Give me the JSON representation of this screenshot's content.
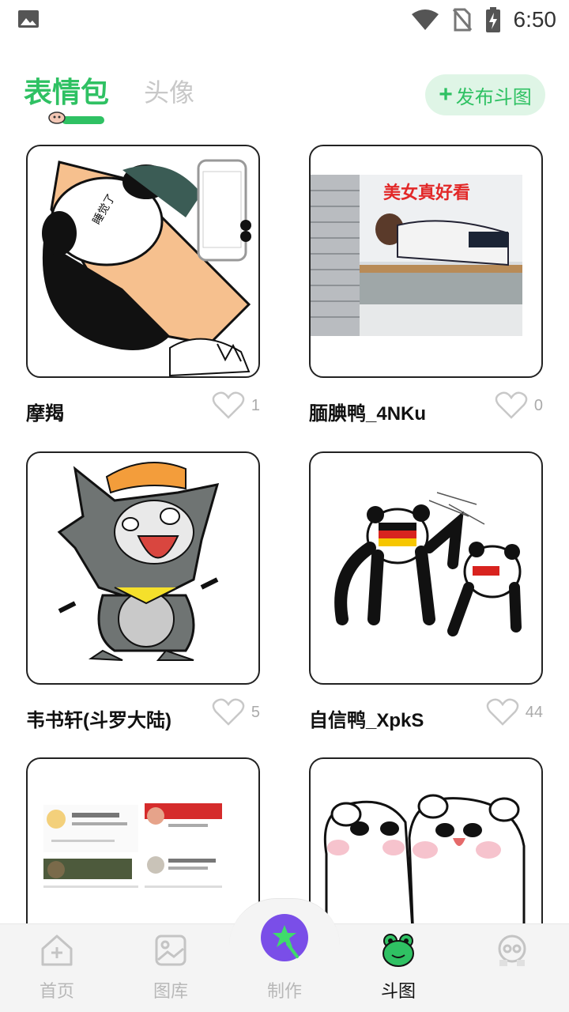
{
  "status_bar": {
    "time": "6:50",
    "icons": [
      "image-notification-icon",
      "wifi-icon",
      "no-sim-icon",
      "battery-charging-icon"
    ]
  },
  "header": {
    "tabs": [
      {
        "label": "表情包",
        "active": true
      },
      {
        "label": "头像",
        "active": false
      }
    ],
    "publish_button": {
      "label": "发布斗图",
      "icon": "plus-icon"
    }
  },
  "cards": [
    {
      "title": "摩羯",
      "likes": "1",
      "image": "panda-meme-sleeping"
    },
    {
      "title": "腼腆鸭_4NKu",
      "likes": "0",
      "image": "photo-man-lying-bed",
      "caption": "美女真好看"
    },
    {
      "title": "韦书轩(斗罗大陆)",
      "likes": "5",
      "image": "angry-grey-wolf"
    },
    {
      "title": "自信鸭_XpkS",
      "likes": "44",
      "image": "panda-slap-flags"
    },
    {
      "title": "",
      "likes": "",
      "image": "qq-profile-cards"
    },
    {
      "title": "",
      "likes": "",
      "image": "two-white-bears"
    }
  ],
  "bottom_nav": {
    "items": [
      {
        "label": "首页",
        "icon": "home-icon",
        "active": false
      },
      {
        "label": "图库",
        "icon": "gallery-icon",
        "active": false
      },
      {
        "label": "制作",
        "icon": "magic-wand-icon",
        "active": false
      },
      {
        "label": "斗图",
        "icon": "frog-icon",
        "active": true
      },
      {
        "label": "",
        "icon": "profile-icon",
        "active": false
      }
    ]
  },
  "colors": {
    "accent": "#2fc163",
    "accent_light": "#dff5e6",
    "make_button": "#7a4ee8",
    "muted": "#b8b8b8"
  }
}
